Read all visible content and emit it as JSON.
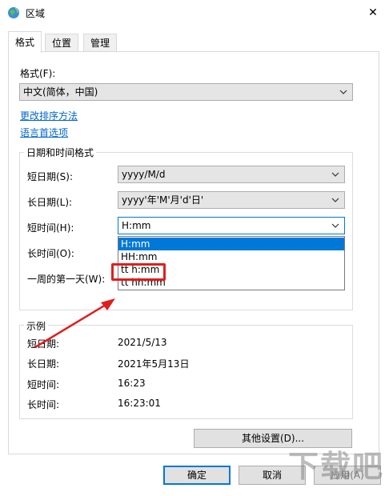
{
  "window": {
    "title": "区域",
    "close_glyph": "✕"
  },
  "tabs": [
    {
      "label": "格式",
      "active": true
    },
    {
      "label": "位置",
      "active": false
    },
    {
      "label": "管理",
      "active": false
    }
  ],
  "format_section": {
    "label": "格式(F):",
    "selected": "中文(简体，中国)",
    "link_sort": "更改排序方法",
    "link_lang": "语言首选项"
  },
  "datetime_group": {
    "title": "日期和时间格式",
    "short_date": {
      "label": "短日期(S):",
      "value": "yyyy/M/d"
    },
    "long_date": {
      "label": "长日期(L):",
      "value": "yyyy'年'M'月'd'日'"
    },
    "short_time": {
      "label": "短时间(H):",
      "value": "H:mm"
    },
    "long_time": {
      "label": "长时间(O):"
    },
    "first_day": {
      "label": "一周的第一天(W):"
    }
  },
  "dropdown_options": [
    "H:mm",
    "HH:mm",
    "tt h:mm",
    "tt hh:mm"
  ],
  "example_group": {
    "title": "示例",
    "rows": [
      {
        "label": "短日期:",
        "value": "2021/5/13"
      },
      {
        "label": "长日期:",
        "value": "2021年5月13日"
      },
      {
        "label": "短时间:",
        "value": "16:23"
      },
      {
        "label": "长时间:",
        "value": "16:23:01"
      }
    ]
  },
  "buttons": {
    "other_settings": "其他设置(D)...",
    "ok": "确定",
    "cancel": "取消",
    "apply": "应用(A)"
  },
  "colors": {
    "accent": "#0078d7",
    "highlight": "#e01e1e",
    "link": "#0066cc"
  },
  "watermark": "下载吧"
}
